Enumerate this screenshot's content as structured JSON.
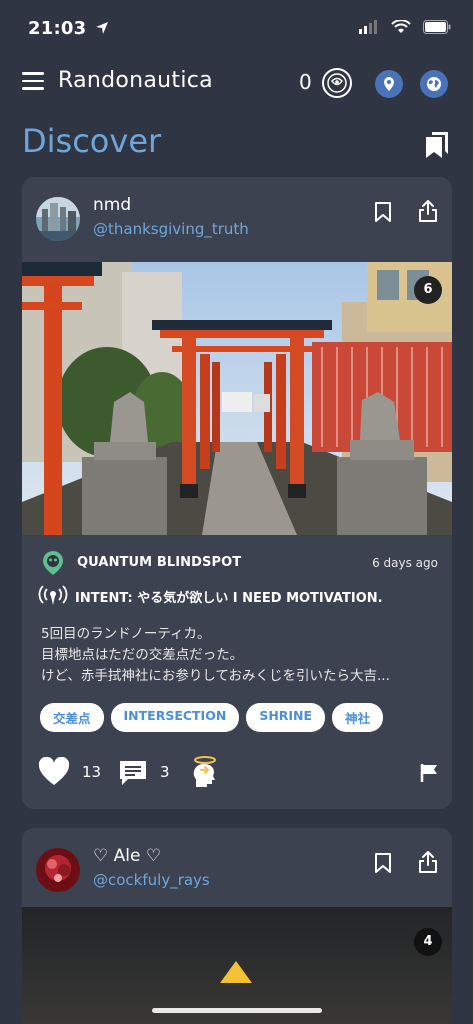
{
  "status_bar": {
    "time": "21:03"
  },
  "header": {
    "app_title": "Randonautica",
    "coin_count": "0"
  },
  "page": {
    "title": "Discover"
  },
  "posts": [
    {
      "user_name": "nmd",
      "user_handle": "@thanksgiving_truth",
      "photo_count": "6",
      "point_type": "QUANTUM BLINDSPOT",
      "time_ago": "6 days ago",
      "intent": "INTENT: やる気が欲しい  I NEED MOTIVATION.",
      "body_lines": [
        "5回目のランドノーティカ。",
        "目標地点はただの交差点だった。",
        "けど、赤手拭神社にお参りしておみくじを引いたら大吉..."
      ],
      "tags": [
        "交差点",
        "INTERSECTION",
        "SHRINE",
        "神社"
      ],
      "likes": "13",
      "comments": "3"
    },
    {
      "user_name": "♡ Ale ♡",
      "user_handle": "@cockfuly_rays",
      "photo_count": "4"
    }
  ],
  "colors": {
    "background": "#2f3542",
    "card": "#3c4250",
    "accent": "#6ea6da",
    "header_circle": "#4a72b8",
    "point_green": "#5fbf8f"
  }
}
